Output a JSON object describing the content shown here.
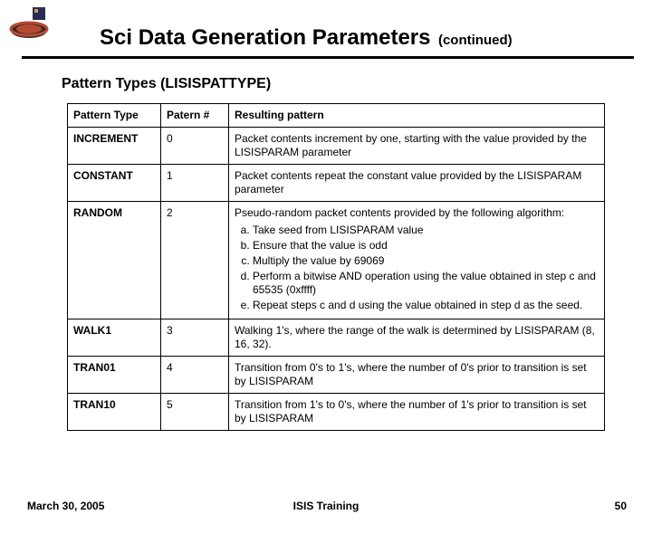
{
  "header": {
    "title": "Sci Data Generation Parameters",
    "suffix": "(continued)"
  },
  "subtitle": "Pattern Types (LISISPATTYPE)",
  "table": {
    "headers": [
      "Pattern Type",
      "Patern #",
      "Resulting pattern"
    ],
    "rows": [
      {
        "name": "INCREMENT",
        "num": "0",
        "desc": "Packet contents increment by one, starting with the value provided by the LISISPARAM parameter"
      },
      {
        "name": "CONSTANT",
        "num": "1",
        "desc": "Packet contents repeat the constant value provided by the LISISPARAM parameter"
      },
      {
        "name": "RANDOM",
        "num": "2",
        "desc": "Pseudo-random packet contents provided by the following algorithm:",
        "algo": [
          "Take seed from LISISPARAM value",
          "Ensure that the value is odd",
          "Multiply the value by 69069",
          "Perform a bitwise AND operation using the value obtained in step c and 65535 (0xffff)",
          "Repeat steps c and d using the value obtained in step d as the seed."
        ]
      },
      {
        "name": "WALK1",
        "num": "3",
        "desc": "Walking 1's, where the range of the walk is determined by LISISPARAM (8, 16, 32)."
      },
      {
        "name": "TRAN01",
        "num": "4",
        "desc": "Transition from 0's to 1's, where the number of 0's prior to transition is set by LISISPARAM"
      },
      {
        "name": "TRAN10",
        "num": "5",
        "desc": "Transition from 1's to 0's, where the number of 1's prior to transition is set by LISISPARAM"
      }
    ]
  },
  "footer": {
    "date": "March 30, 2005",
    "center": "ISIS Training",
    "page": "50"
  }
}
